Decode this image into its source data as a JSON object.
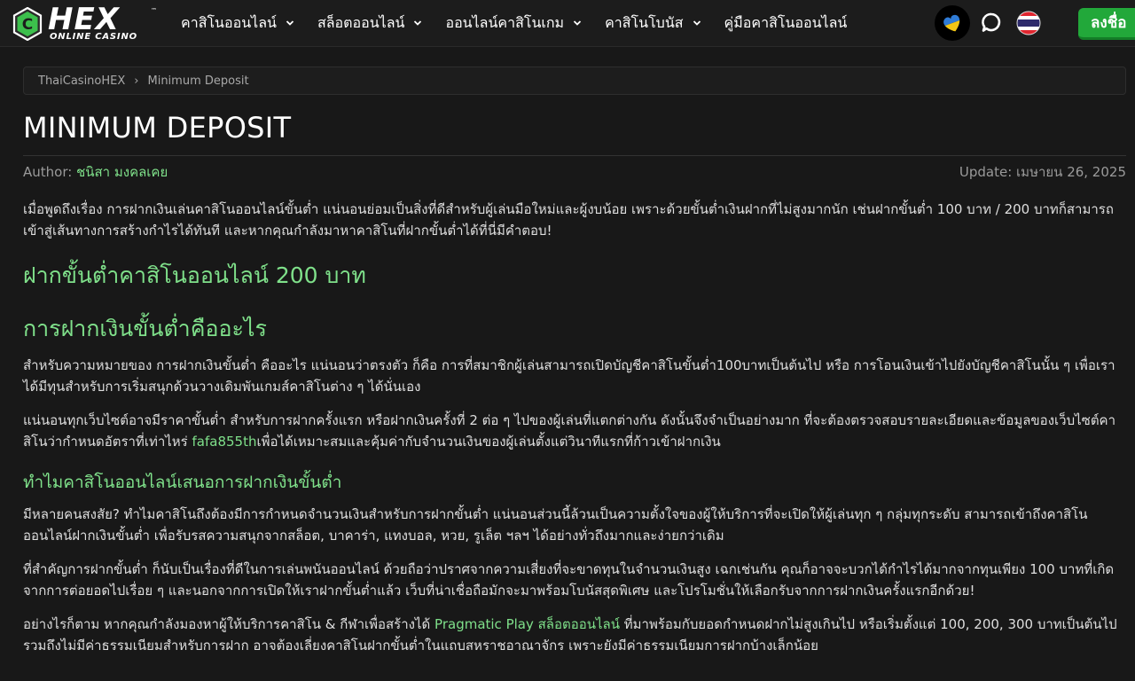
{
  "brand": {
    "name": "HEX",
    "tagline": "ONLINE CASINO",
    "tm": "™"
  },
  "nav": [
    {
      "label": "คาสิโนออนไลน์"
    },
    {
      "label": "สล็อตออนไลน์"
    },
    {
      "label": "ออนไลน์คาสิโนเกม"
    },
    {
      "label": "คาสิโนโบนัส"
    },
    {
      "label": "คู่มือคาสิโนออนไลน์"
    }
  ],
  "signup_label": "ลงชื่อ",
  "breadcrumb": {
    "home": "ThaiCasinoHEX",
    "separator": "›",
    "current": "Minimum Deposit"
  },
  "title": "MINIMUM DEPOSIT",
  "meta": {
    "author_label": "Author:",
    "author_name": "ชนิสา มงคลเคย",
    "update": "Update: เมษายน 26, 2025"
  },
  "content": {
    "intro": "เมื่อพูดถึงเรื่อง การฝากเงินเล่นคาสิโนออนไลน์ขั้นต่ำ แน่นอนย่อมเป็นสิ่งที่ดีสำหรับผู้เล่นมือใหม่และผู้งบน้อย เพราะด้วยขั้นต่ำเงินฝากที่ไม่สูงมากนัก เช่นฝากขั้นต่ำ 100 บาท / 200 บาทก็สามารถเข้าสู่เส้นทางการสร้างกำไรได้ทันที และหากคุณกำลังมาหาคาสิโนที่ฝากขั้นต่ำได้ที่นี่มีคำตอบ!",
    "h2_1": "ฝากขั้นต่ำคาสิโนออนไลน์ 200 บาท",
    "h2_2": "การฝากเงินขั้นต่ำคืออะไร",
    "p1": "สำหรับความหมายของ การฝากเงินขั้นต่ำ คืออะไร แน่นอนว่าตรงตัว ก็คือ การที่สมาชิกผู้เล่นสามารถเปิดบัญชีคาสิโนขั้นต่ำ100บาทเป็นต้นไป หรือ การโอนเงินเข้าไปยังบัญชีคาสิโนนั้น ๆ เพื่อเราได้มีทุนสำหรับการเริ่มสนุกด้วนวางเดิมพันเกมส์คาสิโนต่าง ๆ ได้นั่นเอง",
    "p2_before": "แน่นอนทุกเว็บไซต์อาจมีราคาขั้นต่ำ สำหรับการฝากครั้งแรก หรือฝากเงินครั้งที่ 2 ต่อ ๆ ไปของผู้เล่นที่แตกต่างกัน ดังนั้นจึงจำเป็นอย่างมาก ที่จะต้องตรวจสอบรายละเอียดและข้อมูลของเว็บไซต์คาสิโนว่ากำหนดอัตราที่เท่าไหร่ ",
    "p2_link": "fafa855th",
    "p2_after": "เพื่อได้เหมาะสมและคุ้มค่ากับจำนวนเงินของผู้เล่นตั้งแต่วินาทีแรกที่ก้าวเข้าฝากเงิน",
    "h3_1": "ทำไมคาสิโนออนไลน์เสนอการฝากเงินขั้นต่ำ",
    "p3": "มีหลายคนสงสัย? ทำไมคาสิโนถึงต้องมีการกำหนดจำนวนเงินสำหรับการฝากขั้นต่ำ แน่นอนส่วนนี้ล้วนเป็นความตั้งใจของผู้ให้บริการที่จะเปิดให้ผู้เล่นทุก ๆ กลุ่มทุกระดับ สามารถเข้าถึงคาสิโนออนไลน์ฝากเงินขั้นต่ำ เพื่อรับรสความสนุกจากสล็อต, บาคาร่า, แทงบอล, หวย, รูเล็ต ฯลฯ ได้อย่างทั่วถึงมากและง่ายกว่าเดิม",
    "p4": "ที่สำคัญการฝากขั้นต่ำ ก็นับเป็นเรื่องที่ดีในการเล่นพนันออนไลน์ ด้วยถือว่าปราศจากความเสี่ยงที่จะขาดทุนในจำนวนเงินสูง เฉกเช่นกัน คุณก็อาจจะบวกได้กำไรได้มากจากทุนเพียง 100 บาทที่เกิดจากการต่อยอดไปเรื่อย ๆ และนอกจากการเปิดให้เราฝากขั้นต่ำแล้ว เว็บที่น่าเชื่อถือมักจะมาพร้อมโบนัสสุดพิเศษ และโปรโมชั่นให้เลือกรับจากการฝากเงินครั้งแรกอีกด้วย!",
    "p5_before": "อย่างไรก็ตาม หากคุณกำลังมองหาผู้ให้บริการคาสิโน & กีฬาเพื่อสร้างได้ ",
    "p5_link": "Pragmatic Play สล็อตออนไลน์",
    "p5_after": " ที่มาพร้อมกับยอดกำหนดฝากไม่สูงเกินไป หรือเริ่มตั้งแต่ 100, 200, 300 บาทเป็นต้นไป รวมถึงไม่มีค่าธรรมเนียมสำหรับการฝาก อาจต้องเลี่ยงคาสิโนฝากขั้นต่ำในแถบสหราชอาณาจักร เพราะยังมีค่าธรรมเนียมการฝากบ้างเล็กน้อย"
  },
  "colors": {
    "accent": "#7fe08a",
    "signup": "#22a83a",
    "background": "#181818"
  },
  "icons": [
    "hex-logo-icon",
    "chevron-down-icon",
    "heart-ukraine-icon",
    "chat-icon",
    "thailand-flag-icon"
  ]
}
